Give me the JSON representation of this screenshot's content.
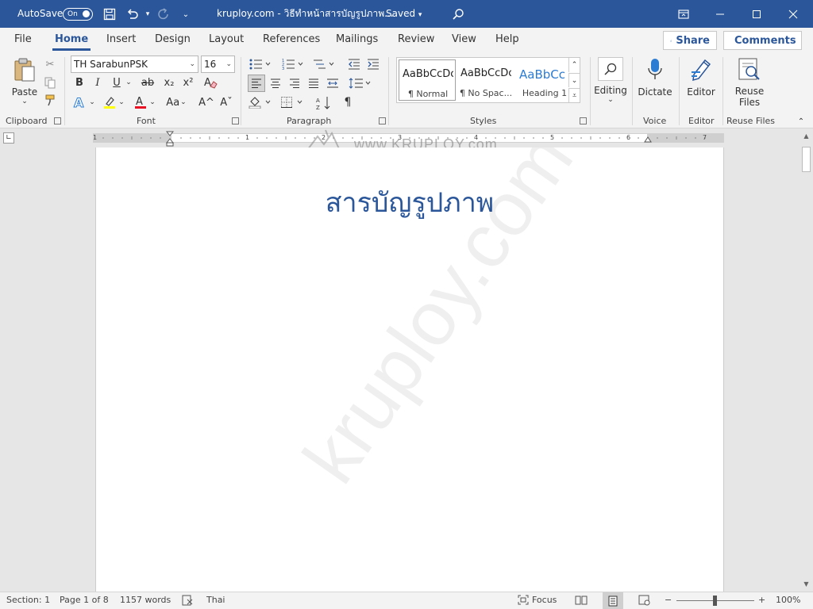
{
  "titlebar": {
    "autosave_label": "AutoSave",
    "autosave_state": "On",
    "doc_title": "kruploy.com - วิธีทำหน้าสารบัญรูปภาพ...",
    "saved_status": "Saved",
    "accent": "#2b579a"
  },
  "tabs": [
    "File",
    "Home",
    "Insert",
    "Design",
    "Layout",
    "References",
    "Mailings",
    "Review",
    "View",
    "Help"
  ],
  "active_tab": "Home",
  "ribbon_right": {
    "share": "Share",
    "comments": "Comments"
  },
  "clipboard": {
    "paste": "Paste",
    "label": "Clipboard"
  },
  "font": {
    "name": "TH SarabunPSK",
    "size": "16",
    "label": "Font",
    "bold": "B",
    "italic": "I",
    "underline": "U",
    "strike": "ab",
    "sub": "x₂",
    "sup": "x²",
    "font_color_glyph": "A",
    "change_case": "Aa",
    "grow": "A^",
    "shrink": "Aˇ"
  },
  "paragraph": {
    "label": "Paragraph",
    "pilcrow": "¶"
  },
  "styles": {
    "label": "Styles",
    "items": [
      {
        "preview": "AaBbCcDc",
        "name": "¶ Normal"
      },
      {
        "preview": "AaBbCcDc",
        "name": "¶ No Spac..."
      },
      {
        "preview": "AaBbCc",
        "name": "Heading 1"
      }
    ]
  },
  "editing": {
    "label": "Editing"
  },
  "voice": {
    "button": "Dictate",
    "label": "Voice"
  },
  "editor": {
    "button": "Editor",
    "label": "Editor"
  },
  "reuse": {
    "button_line1": "Reuse",
    "button_line2": "Files",
    "label": "Reuse Files"
  },
  "ruler": {
    "numbers": [
      "1",
      "1",
      "2",
      "3",
      "4",
      "5",
      "6",
      "7"
    ]
  },
  "document": {
    "title": "สารบัญรูปภาพ",
    "watermark": "kruploy.com",
    "top_watermark": "www.KRUPLOY.com"
  },
  "statusbar": {
    "section": "Section: 1",
    "page": "Page 1 of 8",
    "words": "1157 words",
    "language": "Thai",
    "focus": "Focus",
    "zoom": "100%",
    "minus": "−",
    "plus": "+"
  }
}
